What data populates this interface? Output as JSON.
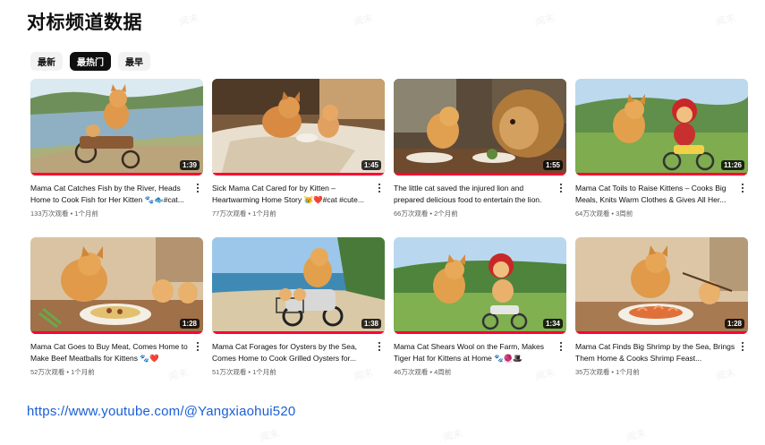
{
  "page_title": "对标频道数据",
  "chips": [
    {
      "label": "最新",
      "active": false
    },
    {
      "label": "最热门",
      "active": true
    },
    {
      "label": "最早",
      "active": false
    }
  ],
  "videos": [
    {
      "title": "Mama Cat Catches Fish by the River, Heads Home to Cook Fish for Her Kitten 🐾🐟#cat...",
      "views": "133万次观看",
      "age": "1个月前",
      "duration": "1:39"
    },
    {
      "title": "Sick Mama Cat Cared for by Kitten – Heartwarming Home Story 😿❤️#cat #cute...",
      "views": "77万次观看",
      "age": "1个月前",
      "duration": "1:45"
    },
    {
      "title": "The little cat saved the injured lion and prepared delicious food to entertain the lion.",
      "views": "66万次观看",
      "age": "2个月前",
      "duration": "1:55"
    },
    {
      "title": "Mama Cat Toils to Raise Kittens – Cooks Big Meals, Knits Warm Clothes & Gives All Her...",
      "views": "64万次观看",
      "age": "3周前",
      "duration": "11:26"
    },
    {
      "title": "Mama Cat Goes to Buy Meat, Comes Home to Make Beef Meatballs for Kittens 🐾❤️",
      "views": "52万次观看",
      "age": "1个月前",
      "duration": "1:28"
    },
    {
      "title": "Mama Cat Forages for Oysters by the Sea, Comes Home to Cook Grilled Oysters for...",
      "views": "51万次观看",
      "age": "1个月前",
      "duration": "1:38"
    },
    {
      "title": "Mama Cat Shears Wool on the Farm, Makes Tiger Hat for Kittens at Home 🐾🧶🎩",
      "views": "46万次观看",
      "age": "4周前",
      "duration": "1:34"
    },
    {
      "title": "Mama Cat Finds Big Shrimp by the Sea, Brings Them Home & Cooks Shrimp Feast...",
      "views": "35万次观看",
      "age": "1个月前",
      "duration": "1:28"
    }
  ],
  "meta_separator": " • ",
  "channel_url": "https://www.youtube.com/@Yangxiaohui520",
  "watermark": "闻末",
  "colors": {
    "accent": "#ff0033",
    "link": "#1a5fd6",
    "chip_active": "#0f0f0f"
  }
}
